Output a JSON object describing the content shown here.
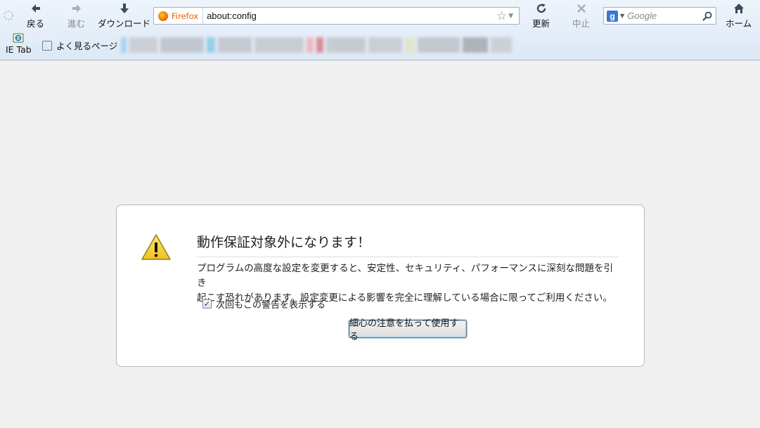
{
  "toolbar": {
    "back_label": "戻る",
    "forward_label": "進む",
    "download_label": "ダウンロード",
    "reload_label": "更新",
    "stop_label": "中止",
    "home_label": "ホーム"
  },
  "urlbar": {
    "identity_label": "Firefox",
    "url": "about:config"
  },
  "search": {
    "engine": "Google",
    "placeholder": "Google"
  },
  "bookmarks": {
    "items": [
      {
        "label": "IE Tab",
        "icon": "ie-tab-icon"
      },
      {
        "label": "よく見るページ",
        "icon": "most-visited-icon"
      }
    ],
    "blurred_count": 14
  },
  "warning": {
    "title": "動作保証対象外になります！",
    "message_line1": "プログラムの高度な設定を変更すると、安定性、セキュリティ、パフォーマンスに深刻な問題を引き",
    "message_line2": "起こす恐れがあります。設定変更による影響を完全に理解している場合に限ってご利用ください。",
    "show_again_label": "次回もこの警告を表示する",
    "show_again_checked": true,
    "proceed_button": "細心の注意を払って使用する"
  },
  "colors": {
    "toolbar_top": "#eef4fb",
    "toolbar_bottom": "#dde8f5",
    "page_bg": "#f0f0f0",
    "firefox_orange": "#e66000",
    "warning_yellow": "#f5d33b"
  }
}
